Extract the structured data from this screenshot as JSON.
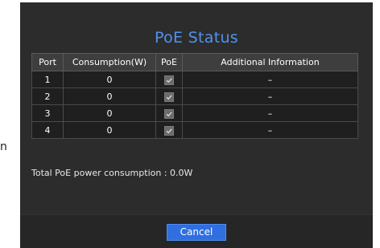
{
  "side_text": "n",
  "dialog": {
    "title": "PoE Status",
    "table": {
      "headers": {
        "port": "Port",
        "consumption": "Consumption(W)",
        "poe": "PoE",
        "info": "Additional Information"
      },
      "rows": [
        {
          "port": "1",
          "consumption": "0",
          "poe_checked": true,
          "info": "–"
        },
        {
          "port": "2",
          "consumption": "0",
          "poe_checked": true,
          "info": "–"
        },
        {
          "port": "3",
          "consumption": "0",
          "poe_checked": true,
          "info": "–"
        },
        {
          "port": "4",
          "consumption": "0",
          "poe_checked": true,
          "info": "–"
        }
      ]
    },
    "total_text": "Total PoE power consumption : 0.0W",
    "cancel_label": "Cancel"
  },
  "colors": {
    "dialog_bg": "#2c2c2c",
    "title": "#4f93f0",
    "button": "#2f6fe0"
  },
  "icons": {
    "poe_check": "checkmark-icon"
  }
}
